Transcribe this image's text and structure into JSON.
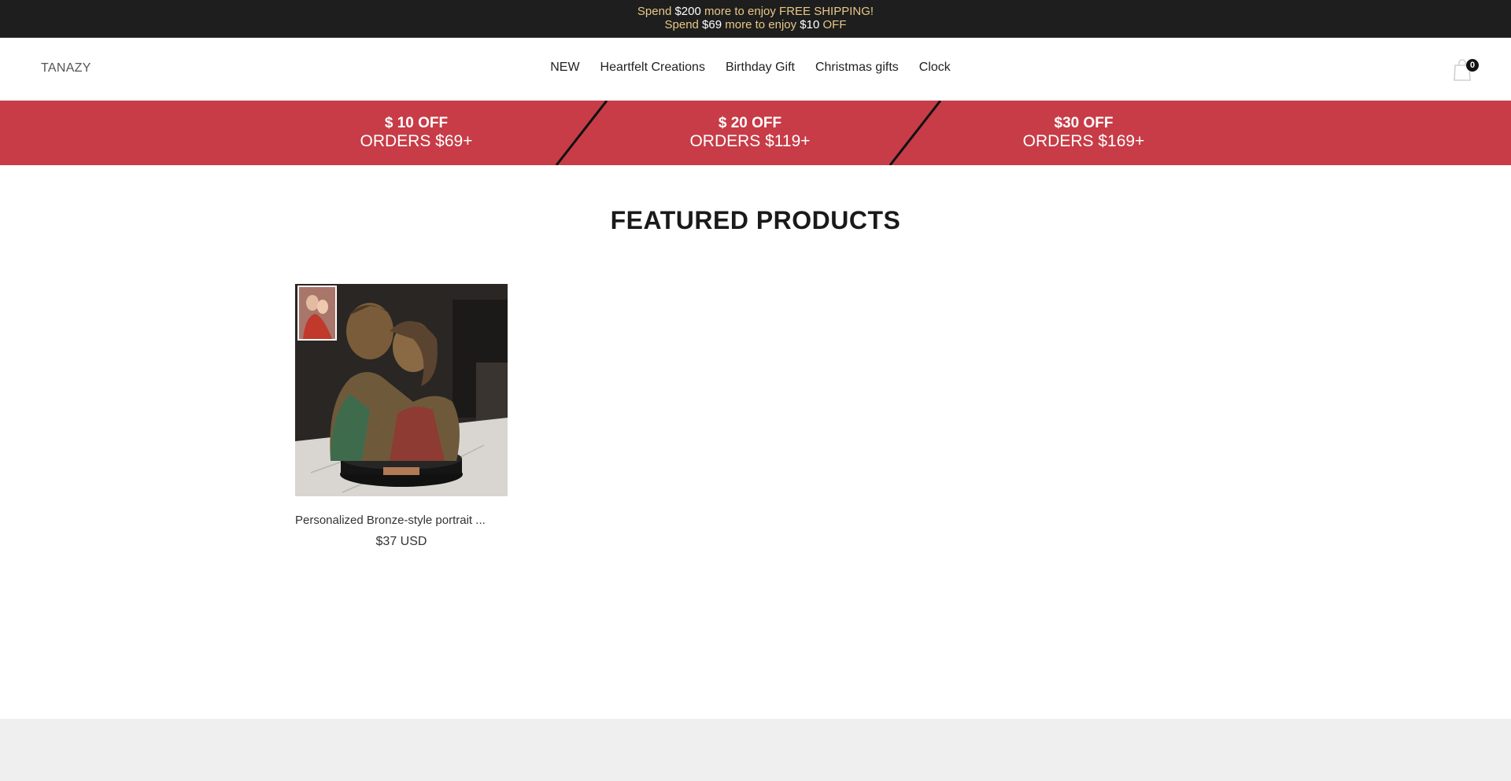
{
  "announcement": {
    "line1": [
      "Spend ",
      "$200",
      " more to enjoy FREE SHIPPING!"
    ],
    "line2": [
      "Spend ",
      "$69",
      " more to enjoy ",
      "$10",
      " OFF"
    ]
  },
  "header": {
    "logo": "TANAZY",
    "nav": [
      "NEW",
      "Heartfelt Creations",
      "Birthday Gift",
      "Christmas gifts",
      "Clock"
    ],
    "cart_count": "0",
    "cart_icon": "shopping-bag-icon"
  },
  "promo": {
    "tiers": [
      {
        "line1": "$ 10 OFF",
        "line2": "ORDERS $69+"
      },
      {
        "line1": "$ 20 OFF",
        "line2": "ORDERS $119+"
      },
      {
        "line1": "$30 OFF",
        "line2": "ORDERS $169+"
      }
    ],
    "color": "#c73c47"
  },
  "featured": {
    "title": "FEATURED PRODUCTS",
    "products": [
      {
        "name": "Personalized Bronze-style portrait ...",
        "price": "$37 USD"
      }
    ]
  },
  "colors": {
    "announcement_bg": "#1e1e1e",
    "announcement_text": "#e7c887",
    "promo_bg": "#c73c47",
    "footer_bg": "#efefef"
  }
}
